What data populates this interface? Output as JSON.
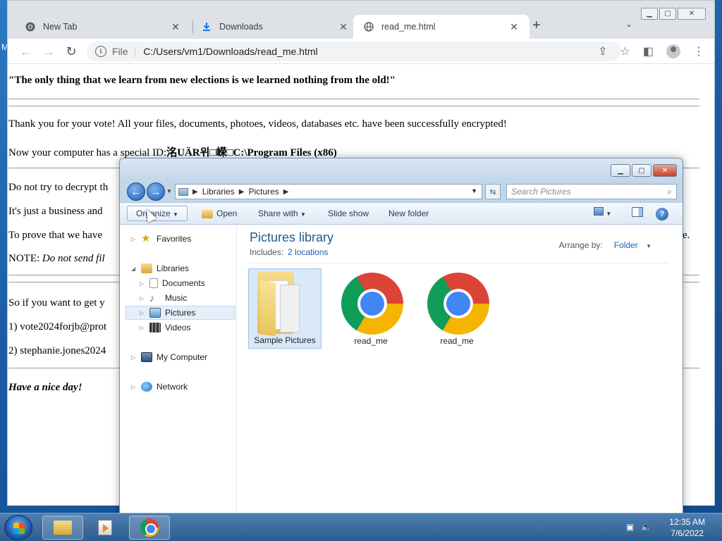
{
  "desktop": {
    "edge_text": "M"
  },
  "browser": {
    "tabs": [
      {
        "title": "New Tab",
        "icon": "chrome-icon"
      },
      {
        "title": "Downloads",
        "icon": "download-icon"
      },
      {
        "title": "read_me.html",
        "icon": "globe-icon"
      }
    ],
    "omnibox": {
      "scheme_label": "File",
      "url": "C:/Users/vm1/Downloads/read_me.html"
    }
  },
  "page": {
    "quote": "\"The only thing that we learn from new elections is we learned nothing from the old!\"",
    "thanks": "Thank you for your vote! All your files, documents, photoes, videos, databases etc. have been successfully encrypted!",
    "id_prefix": "Now your computer has a special ID:",
    "id_value": "洺UÄR위□嵘□C:\\Program Files (x86)",
    "decrypt_line": "Do not try to decrypt th",
    "business_line": "It's just a business and",
    "prove_line": "To prove that we have",
    "prove_tail": "e.",
    "note_prefix": "NOTE: ",
    "note_italic": "Do not send fil",
    "getback_line": "So if you want to get y",
    "contact_1": "1) vote2024forjb@prot",
    "contact_2": "2) stephanie.jones2024",
    "closing": "Have a nice day!"
  },
  "explorer": {
    "breadcrumb": [
      "Libraries",
      "Pictures"
    ],
    "search_placeholder": "Search Pictures",
    "commands": {
      "organize": "Organize",
      "open": "Open",
      "share_with": "Share with",
      "slide_show": "Slide show",
      "new_folder": "New folder"
    },
    "sidebar": {
      "favorites": "Favorites",
      "libraries": "Libraries",
      "documents": "Documents",
      "music": "Music",
      "pictures": "Pictures",
      "videos": "Videos",
      "my_computer": "My Computer",
      "network": "Network"
    },
    "library": {
      "title": "Pictures library",
      "includes_label": "Includes:",
      "locations": "2 locations",
      "arrange_label": "Arrange by:",
      "arrange_value": "Folder"
    },
    "items": [
      {
        "label": "Sample Pictures",
        "type": "folder"
      },
      {
        "label": "read_me",
        "type": "chrome-html"
      },
      {
        "label": "read_me",
        "type": "chrome-html"
      }
    ]
  },
  "taskbar": {
    "time": "12:35 AM",
    "date": "7/6/2022"
  }
}
